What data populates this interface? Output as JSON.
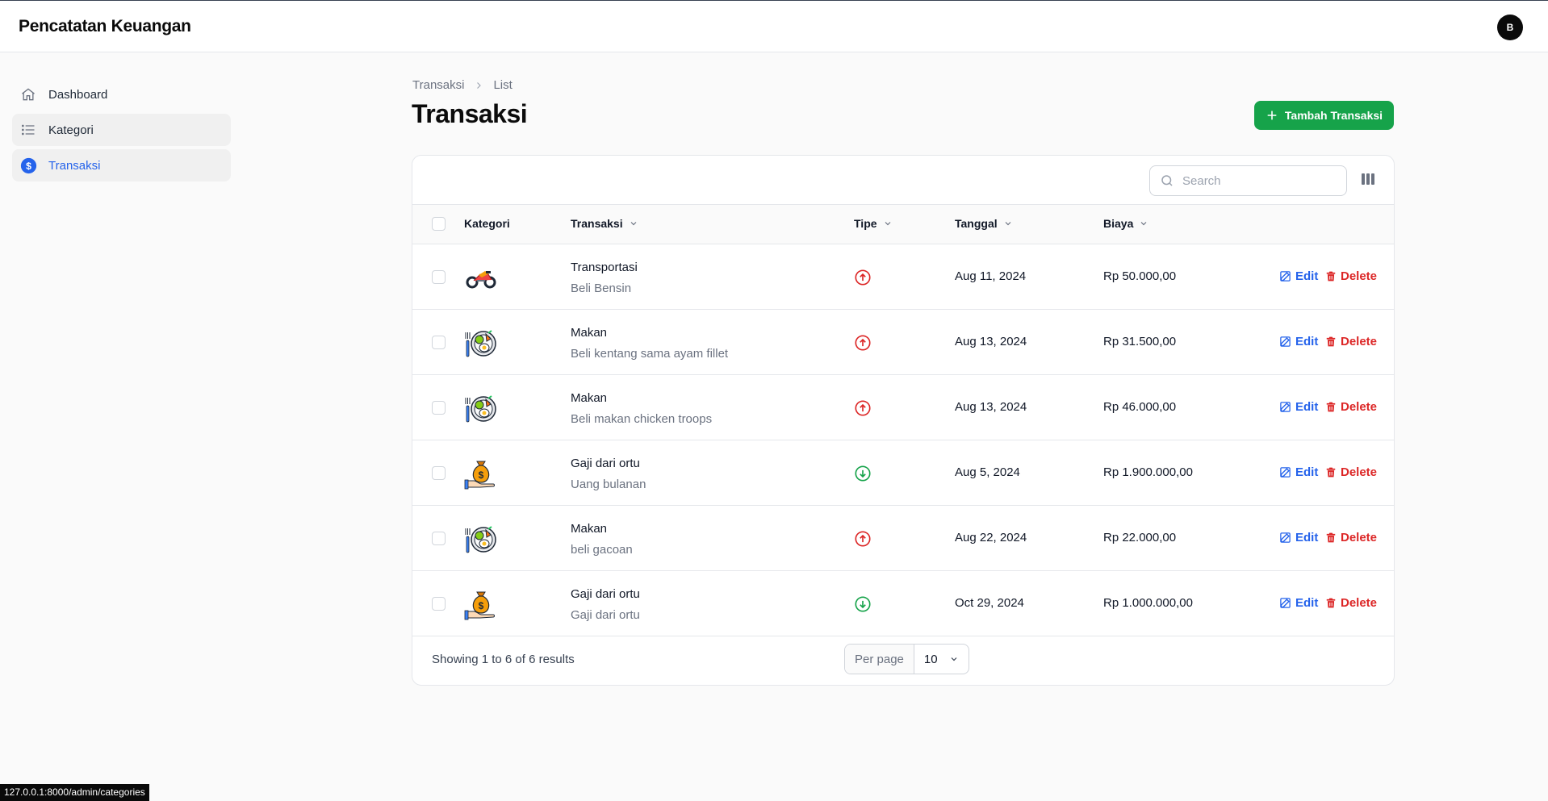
{
  "app": {
    "title": "Pencatatan Keuangan",
    "avatar_initial": "B"
  },
  "sidebar": {
    "items": [
      {
        "label": "Dashboard",
        "icon": "home-icon"
      },
      {
        "label": "Kategori",
        "icon": "list-icon"
      },
      {
        "label": "Transaksi",
        "icon": "dollar-circle-icon"
      }
    ]
  },
  "breadcrumb": {
    "items": [
      "Transaksi",
      "List"
    ]
  },
  "page": {
    "title": "Transaksi",
    "add_button": "Tambah Transaksi"
  },
  "search": {
    "placeholder": "Search",
    "value": ""
  },
  "table": {
    "headers": {
      "kategori": "Kategori",
      "transaksi": "Transaksi",
      "tipe": "Tipe",
      "tanggal": "Tanggal",
      "biaya": "Biaya"
    },
    "actions": {
      "edit": "Edit",
      "delete": "Delete"
    },
    "rows": [
      {
        "category_icon": "motorcycle-icon",
        "title": "Transportasi",
        "description": "Beli Bensin",
        "type": "expense",
        "date": "Aug 11, 2024",
        "amount": "Rp 50.000,00"
      },
      {
        "category_icon": "food-plate-icon",
        "title": "Makan",
        "description": "Beli kentang sama ayam fillet",
        "type": "expense",
        "date": "Aug 13, 2024",
        "amount": "Rp 31.500,00"
      },
      {
        "category_icon": "food-plate-icon",
        "title": "Makan",
        "description": "Beli makan chicken troops",
        "type": "expense",
        "date": "Aug 13, 2024",
        "amount": "Rp 46.000,00"
      },
      {
        "category_icon": "money-bag-icon",
        "title": "Gaji dari ortu",
        "description": "Uang bulanan",
        "type": "income",
        "date": "Aug 5, 2024",
        "amount": "Rp 1.900.000,00"
      },
      {
        "category_icon": "food-plate-icon",
        "title": "Makan",
        "description": "beli gacoan",
        "type": "expense",
        "date": "Aug 22, 2024",
        "amount": "Rp 22.000,00"
      },
      {
        "category_icon": "money-bag-icon",
        "title": "Gaji dari ortu",
        "description": "Gaji dari ortu",
        "type": "income",
        "date": "Oct 29, 2024",
        "amount": "Rp 1.000.000,00"
      }
    ]
  },
  "pagination": {
    "showing": "Showing 1 to 6 of 6 results",
    "per_page_label": "Per page",
    "per_page_value": "10"
  },
  "statusbar": {
    "url": "127.0.0.1:8000/admin/categories"
  },
  "colors": {
    "accent": "#2563eb",
    "success": "#16a34a",
    "danger": "#dc2626"
  }
}
